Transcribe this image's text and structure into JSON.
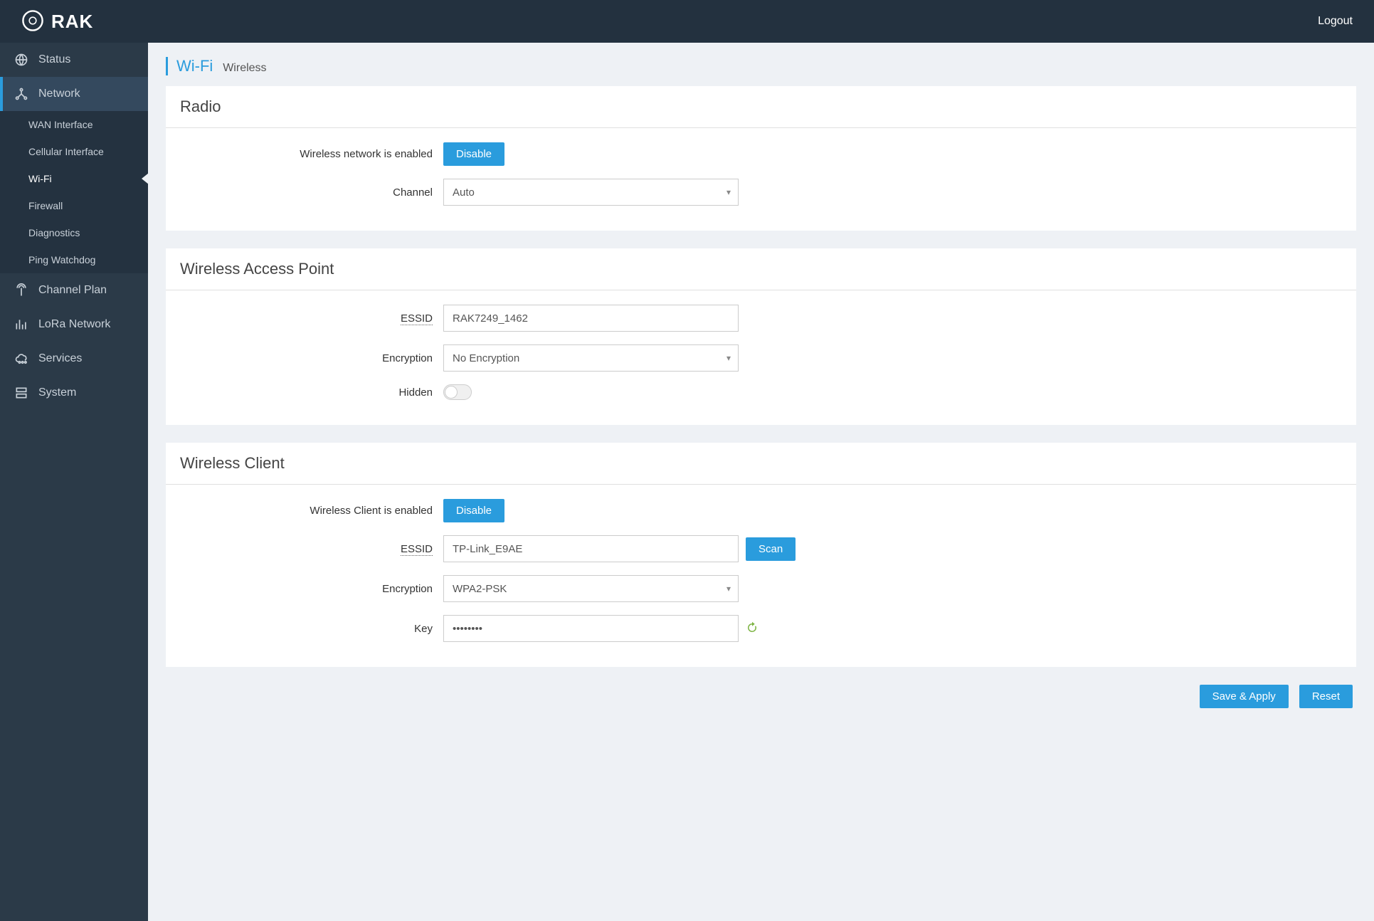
{
  "header": {
    "brand": "RAK",
    "logout": "Logout"
  },
  "sidebar": {
    "items": [
      {
        "label": "Status",
        "icon": "globe-icon"
      },
      {
        "label": "Network",
        "icon": "network-icon"
      },
      {
        "label": "Channel Plan",
        "icon": "antenna-icon"
      },
      {
        "label": "LoRa Network",
        "icon": "bars-icon"
      },
      {
        "label": "Services",
        "icon": "cloud-icon"
      },
      {
        "label": "System",
        "icon": "server-icon"
      }
    ],
    "network_sub": [
      "WAN Interface",
      "Cellular Interface",
      "Wi-Fi",
      "Firewall",
      "Diagnostics",
      "Ping Watchdog"
    ]
  },
  "breadcrumb": {
    "main": "Wi-Fi",
    "sub": "Wireless"
  },
  "panels": {
    "radio": {
      "title": "Radio",
      "status_label": "Wireless network is enabled",
      "disable_btn": "Disable",
      "channel_label": "Channel",
      "channel_value": "Auto"
    },
    "ap": {
      "title": "Wireless Access Point",
      "essid_label": "ESSID",
      "essid_value": "RAK7249_1462",
      "encryption_label": "Encryption",
      "encryption_value": "No Encryption",
      "hidden_label": "Hidden"
    },
    "client": {
      "title": "Wireless Client",
      "status_label": "Wireless Client is enabled",
      "disable_btn": "Disable",
      "essid_label": "ESSID",
      "essid_value": "TP-Link_E9AE",
      "scan_btn": "Scan",
      "encryption_label": "Encryption",
      "encryption_value": "WPA2-PSK",
      "key_label": "Key",
      "key_value": "••••••••"
    }
  },
  "actions": {
    "save": "Save & Apply",
    "reset": "Reset"
  }
}
